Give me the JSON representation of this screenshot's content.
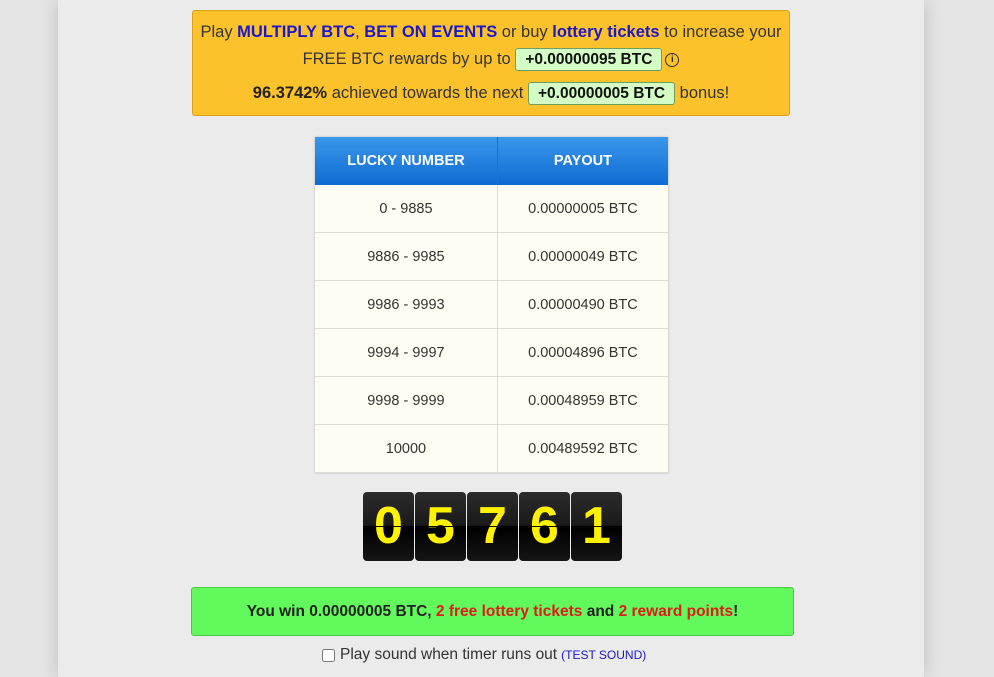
{
  "promo": {
    "play": "Play ",
    "multiply": "MULTIPLY BTC",
    "comma": ", ",
    "bet": "BET ON EVENTS",
    "or_buy": " or buy ",
    "lottery": "lottery tickets",
    "increase": " to increase your",
    "free_rewards": "FREE BTC rewards by up to ",
    "reward_pill": "+0.00000095 BTC",
    "info_icon": "i",
    "percent": "96.3742%",
    "achieved": " achieved towards the next ",
    "bonus_pill": "+0.00000005 BTC",
    "bonus": " bonus!"
  },
  "table": {
    "headers": [
      "LUCKY NUMBER",
      "PAYOUT"
    ],
    "rows": [
      [
        "0 - 9885",
        "0.00000005 BTC"
      ],
      [
        "9886 - 9985",
        "0.00000049 BTC"
      ],
      [
        "9986 - 9993",
        "0.00000490 BTC"
      ],
      [
        "9994 - 9997",
        "0.00004896 BTC"
      ],
      [
        "9998 - 9999",
        "0.00048959 BTC"
      ],
      [
        "10000",
        "0.00489592 BTC"
      ]
    ]
  },
  "lucky_digits": [
    "0",
    "5",
    "7",
    "6",
    "1"
  ],
  "win": {
    "prefix": "You win 0.00000005 BTC, ",
    "tickets": "2 free lottery tickets",
    "and": " and ",
    "points": "2 reward points",
    "suffix": "!"
  },
  "sound": {
    "label": "Play sound when timer runs out",
    "test_open": "(",
    "test_link": "TEST SOUND",
    "test_close": ")"
  },
  "colors": {
    "promo_bg": "#fcc22c",
    "link": "#1c17c9",
    "header_blue": "#0f6bd2",
    "win_bg": "#62f95c",
    "win_red": "#e01b1b",
    "digit_yellow": "#fff200"
  }
}
